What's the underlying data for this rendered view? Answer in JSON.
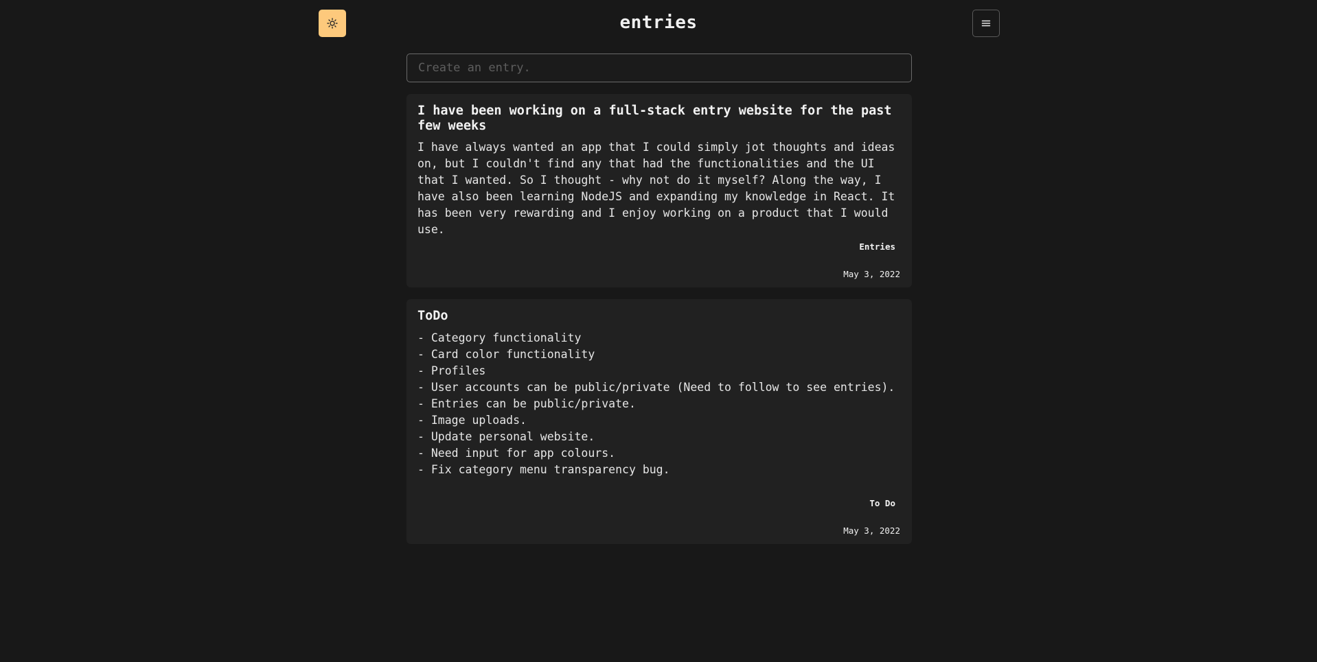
{
  "header": {
    "title": "entries",
    "theme_toggle_icon": "sun-icon",
    "menu_icon": "hamburger-menu-icon",
    "accent_color": "#fdc97c"
  },
  "composer": {
    "placeholder": "Create an entry.",
    "value": ""
  },
  "entries": [
    {
      "title": "I have been working on a full-stack entry website for the past few weeks",
      "body": "I have always wanted an app that I could simply jot thoughts and ideas on, but I couldn't find any that had the functionalities and the UI that I wanted. So I thought - why not do it myself? Along the way, I have also been learning NodeJS and expanding my knowledge in React. It has been very rewarding and I enjoy working on a product that I would use.",
      "category": "Entries",
      "date": "May 3, 2022"
    },
    {
      "title": "ToDo",
      "body": "- Category functionality\n- Card color functionality\n- Profiles\n- User accounts can be public/private (Need to follow to see entries).\n- Entries can be public/private.\n- Image uploads.\n- Update personal website.\n- Need input for app colours.\n- Fix category menu transparency bug.",
      "category": "To Do",
      "date": "May 3, 2022"
    }
  ]
}
